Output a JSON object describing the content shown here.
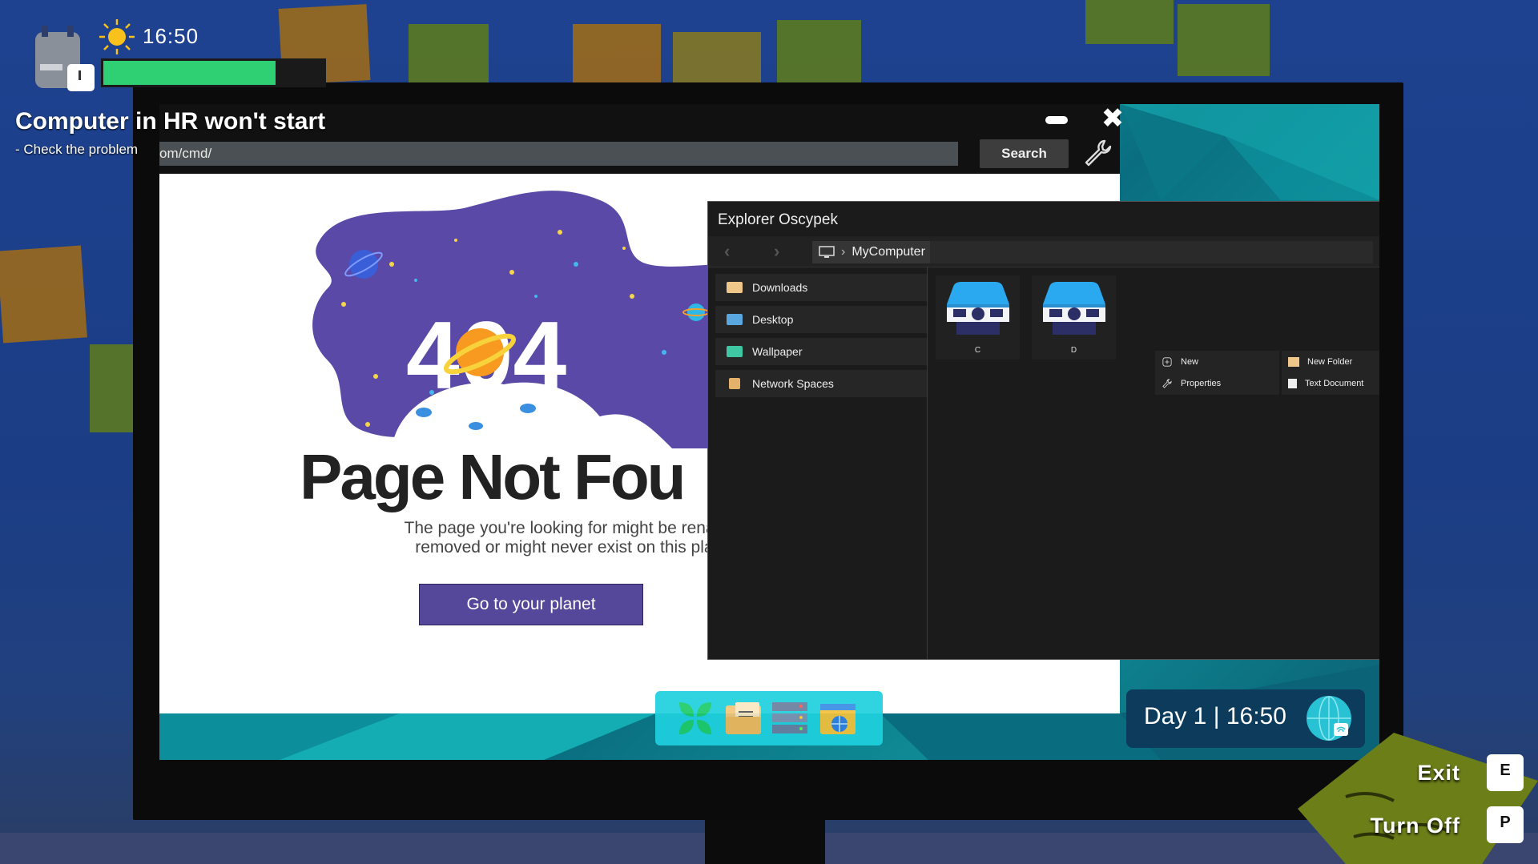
{
  "hud": {
    "time": "16:50",
    "energy_fraction": 0.78,
    "task_title": "Computer in HR won't start",
    "task_subtitle": "- Check the problem"
  },
  "browser": {
    "url": "om/cmd/",
    "search_label": "Search",
    "page_title": "Page Not Fou",
    "page_number": "404",
    "page_desc_line1": "The page you're looking for might be renamed",
    "page_desc_line2": "removed or might never exist on this planet",
    "cta_label": "Go to your planet"
  },
  "explorer": {
    "title": "Explorer Oscypek",
    "breadcrumb": "MyComputer",
    "sidebar": [
      {
        "label": "Downloads",
        "icon": "downloads-folder-icon"
      },
      {
        "label": "Desktop",
        "icon": "desktop-icon"
      },
      {
        "label": "Wallpaper",
        "icon": "wallpaper-icon"
      },
      {
        "label": "Network Spaces",
        "icon": "network-icon"
      }
    ],
    "drives": [
      {
        "label": "C"
      },
      {
        "label": "D"
      }
    ],
    "context_menu": {
      "new": "New",
      "properties": "Properties",
      "new_folder": "New Folder",
      "text_document": "Text Document"
    }
  },
  "taskbar": {
    "apps": [
      "windows-logo-icon",
      "file-manager-icon",
      "server-icon",
      "browser-icon"
    ],
    "clock": "Day 1 | 16:50"
  },
  "hints": [
    {
      "label": "Exit",
      "key": "E"
    },
    {
      "label": "Turn Off",
      "key": "P"
    }
  ],
  "colors": {
    "energy": "#2fcf74",
    "cta": "#55479a",
    "galaxy": "#5a49a6",
    "dock": "#1fd1df"
  }
}
